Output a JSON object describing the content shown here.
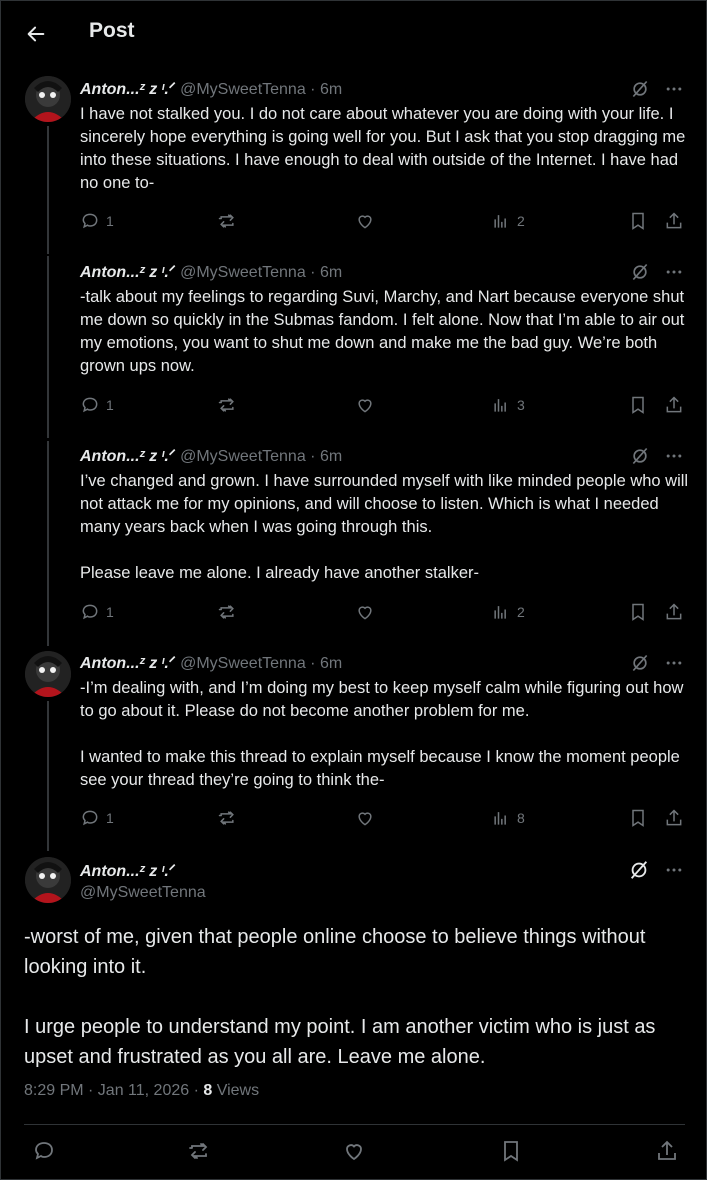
{
  "header": {
    "title": "Post"
  },
  "author": {
    "name": "Anton...ᶻ z ᶦ.ᐟ",
    "handle": "@MySweetTenna"
  },
  "replies": [
    {
      "time": "6m",
      "text": "I have not stalked you. I do not care about whatever you are doing with your life. I sincerely hope everything is going well for you. But I ask that you stop dragging me into these situations. I have enough to deal with outside of the Internet. I have had no one to-",
      "replies": "1",
      "views": "2"
    },
    {
      "time": "6m",
      "text": "-talk about my feelings to regarding Suvi, Marchy, and Nart because everyone shut me down so quickly in the Submas fandom. I felt alone. Now that I’m able to air out my emotions, you want to shut me down and make me the bad guy. We’re both grown ups now.",
      "replies": "1",
      "views": "3"
    },
    {
      "time": "6m",
      "text": "I’ve changed and grown. I have surrounded myself with like minded people who will not attack me for my opinions, and will choose to listen. Which is what I needed many years back when I was going through this.\n\nPlease leave me alone. I already have another stalker-",
      "replies": "1",
      "views": "2"
    },
    {
      "time": "6m",
      "text": "-I’m dealing with, and I’m doing my best to keep myself calm while figuring out how to go about it. Please do not become another problem for me.\n\nI wanted to make this thread to explain myself because I know the moment people see your thread they’re going to think the-",
      "replies": "1",
      "views": "8"
    }
  ],
  "main": {
    "text": "-worst of me, given that people online choose to believe things without looking into it.\n\nI urge people to understand my point. I am another victim who is just as upset and frustrated as you all are. Leave me alone.",
    "timestamp": "8:29 PM · Jan 11, 2026 · ",
    "views_count": "8",
    "views_label": "Views"
  },
  "icons": [
    "back-arrow-icon",
    "grok-icon",
    "more-icon",
    "reply-icon",
    "repost-icon",
    "like-icon",
    "views-icon",
    "bookmark-icon",
    "share-icon"
  ],
  "colors": {
    "background": "#000000",
    "text": "#e7e9ea",
    "muted": "#71767b",
    "border": "#2f3336"
  }
}
